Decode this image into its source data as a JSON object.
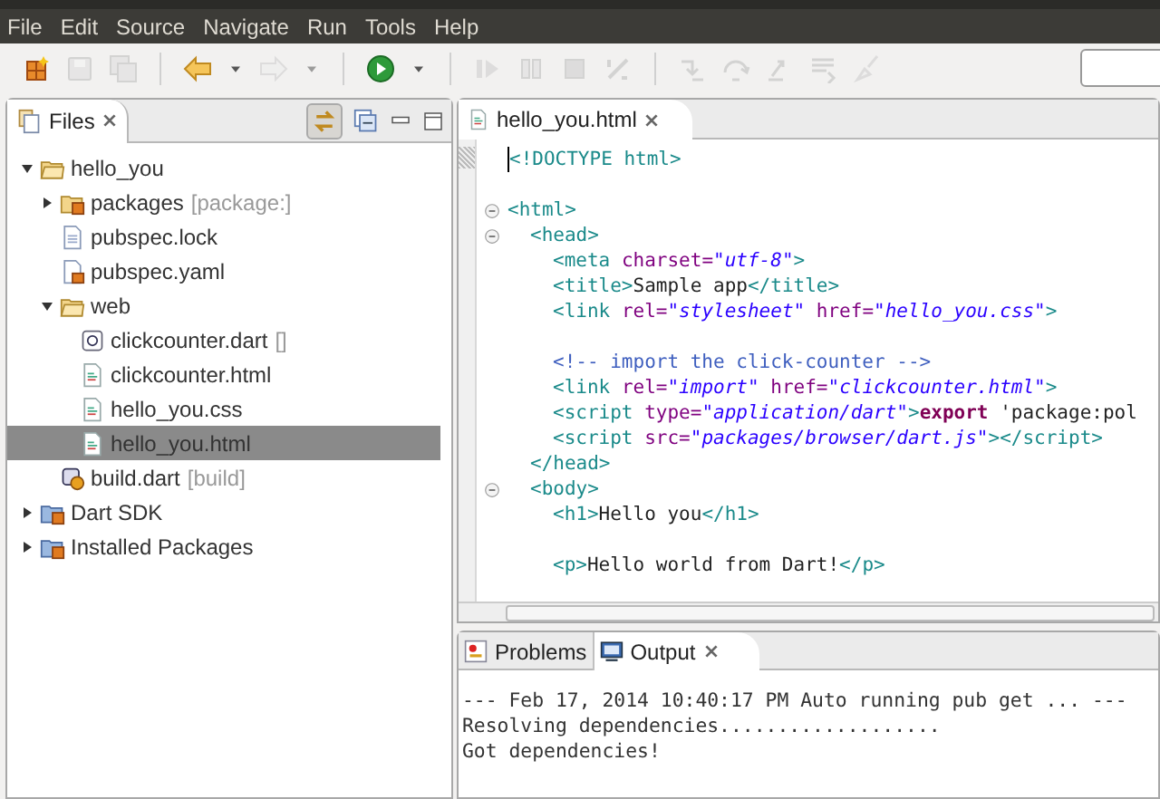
{
  "menu_bar": [
    "File",
    "Edit",
    "Source",
    "Navigate",
    "Run",
    "Tools",
    "Help"
  ],
  "toolbar": [
    {
      "kind": "new",
      "disabled": false
    },
    {
      "kind": "save",
      "disabled": true
    },
    {
      "kind": "save_all",
      "disabled": true
    },
    {
      "kind": "separator"
    },
    {
      "kind": "back",
      "disabled": false
    },
    {
      "kind": "dropdown",
      "disabled": false
    },
    {
      "kind": "forward",
      "disabled": true
    },
    {
      "kind": "dropdown",
      "disabled": true
    },
    {
      "kind": "separator"
    },
    {
      "kind": "run",
      "disabled": false
    },
    {
      "kind": "dropdown",
      "disabled": false
    },
    {
      "kind": "separator"
    },
    {
      "kind": "resume",
      "disabled": true
    },
    {
      "kind": "pause",
      "disabled": true
    },
    {
      "kind": "stop",
      "disabled": true
    },
    {
      "kind": "disconnect",
      "disabled": true
    },
    {
      "kind": "separator"
    },
    {
      "kind": "step_into",
      "disabled": true
    },
    {
      "kind": "step_over",
      "disabled": true
    },
    {
      "kind": "step_return",
      "disabled": true
    },
    {
      "kind": "step_filter",
      "disabled": true
    },
    {
      "kind": "brush",
      "disabled": true
    }
  ],
  "files_view": {
    "title": "Files",
    "link_editor": {
      "selected": true
    },
    "tree": [
      {
        "label": "hello_you",
        "kind": "folder",
        "expanded": true,
        "selected": false,
        "children": [
          {
            "label": "packages",
            "suffix": "[package:]",
            "kind": "package",
            "expanded": false,
            "selected": false
          },
          {
            "label": "pubspec.lock",
            "kind": "file",
            "selected": false
          },
          {
            "label": "pubspec.yaml",
            "kind": "pubspec",
            "selected": false
          },
          {
            "label": "web",
            "kind": "folder",
            "expanded": true,
            "selected": false,
            "children": [
              {
                "label": "clickcounter.dart",
                "suffix": "[]",
                "kind": "dart",
                "selected": false
              },
              {
                "label": "clickcounter.html",
                "kind": "html",
                "selected": false
              },
              {
                "label": "hello_you.css",
                "kind": "html",
                "selected": false
              },
              {
                "label": "hello_you.html",
                "kind": "html",
                "selected": true
              }
            ]
          },
          {
            "label": "build.dart",
            "suffix": "[build]",
            "kind": "build",
            "selected": false
          }
        ]
      },
      {
        "label": "Dart SDK",
        "kind": "library",
        "expanded": false,
        "selected": false
      },
      {
        "label": "Installed Packages",
        "kind": "library",
        "expanded": false,
        "selected": false
      }
    ]
  },
  "editor": {
    "tab": "hello_you.html",
    "lines": [
      {
        "kind": "code",
        "tokens": [
          {
            "kind": "tag",
            "text": "<!DOCTYPE html>"
          }
        ]
      },
      {
        "kind": "blank"
      },
      {
        "kind": "code",
        "tokens": [
          {
            "kind": "tag",
            "text": "<html>"
          }
        ],
        "children": [
          {
            "kind": "code",
            "tokens": [
              {
                "kind": "tag",
                "text": "<head>"
              }
            ],
            "children": [
              {
                "kind": "code",
                "tokens": [
                  {
                    "kind": "tag",
                    "text": "<meta "
                  },
                  {
                    "kind": "attr",
                    "text": "charset="
                  },
                  {
                    "kind": "value",
                    "text": "\"utf-8\""
                  },
                  {
                    "kind": "tag",
                    "text": ">"
                  }
                ]
              },
              {
                "kind": "code",
                "tokens": [
                  {
                    "kind": "tag",
                    "text": "<title>"
                  },
                  {
                    "kind": "text",
                    "text": "Sample app"
                  },
                  {
                    "kind": "tag",
                    "text": "</title>"
                  }
                ]
              },
              {
                "kind": "code",
                "tokens": [
                  {
                    "kind": "tag",
                    "text": "<link "
                  },
                  {
                    "kind": "attr",
                    "text": "rel="
                  },
                  {
                    "kind": "value",
                    "text": "\"stylesheet\""
                  },
                  {
                    "kind": "attr",
                    "text": " href="
                  },
                  {
                    "kind": "value",
                    "text": "\"hello_you.css\""
                  },
                  {
                    "kind": "tag",
                    "text": ">"
                  }
                ]
              },
              {
                "kind": "blank"
              },
              {
                "kind": "code",
                "tokens": [
                  {
                    "kind": "comment",
                    "text": "<!-- import the click-counter -->"
                  }
                ]
              },
              {
                "kind": "code",
                "tokens": [
                  {
                    "kind": "tag",
                    "text": "<link "
                  },
                  {
                    "kind": "attr",
                    "text": "rel="
                  },
                  {
                    "kind": "value",
                    "text": "\"import\""
                  },
                  {
                    "kind": "attr",
                    "text": " href="
                  },
                  {
                    "kind": "value",
                    "text": "\"clickcounter.html\""
                  },
                  {
                    "kind": "tag",
                    "text": ">"
                  }
                ]
              },
              {
                "kind": "code",
                "tokens": [
                  {
                    "kind": "tag",
                    "text": "<script "
                  },
                  {
                    "kind": "attr",
                    "text": "type="
                  },
                  {
                    "kind": "value",
                    "text": "\"application/dart\""
                  },
                  {
                    "kind": "tag",
                    "text": ">"
                  },
                  {
                    "kind": "keyword",
                    "text": "export"
                  },
                  {
                    "kind": "text",
                    "text": " 'package:pol"
                  }
                ]
              },
              {
                "kind": "code",
                "tokens": [
                  {
                    "kind": "tag",
                    "text": "<script "
                  },
                  {
                    "kind": "attr",
                    "text": "src="
                  },
                  {
                    "kind": "value",
                    "text": "\"packages/browser/dart.js\""
                  },
                  {
                    "kind": "tag",
                    "text": "></script>"
                  }
                ]
              }
            ]
          },
          {
            "kind": "code",
            "tokens": [
              {
                "kind": "tag",
                "text": "</head>"
              }
            ]
          },
          {
            "kind": "code",
            "tokens": [
              {
                "kind": "tag",
                "text": "<body>"
              }
            ],
            "children": [
              {
                "kind": "code",
                "tokens": [
                  {
                    "kind": "tag",
                    "text": "<h1>"
                  },
                  {
                    "kind": "text",
                    "text": "Hello you"
                  },
                  {
                    "kind": "tag",
                    "text": "</h1>"
                  }
                ]
              },
              {
                "kind": "blank"
              },
              {
                "kind": "code",
                "tokens": [
                  {
                    "kind": "tag",
                    "text": "<p>"
                  },
                  {
                    "kind": "text",
                    "text": "Hello world from Dart!"
                  },
                  {
                    "kind": "tag",
                    "text": "</p>"
                  }
                ]
              }
            ]
          }
        ]
      }
    ]
  },
  "bottom_panel": {
    "tabs": [
      {
        "label": "Problems",
        "kind": "problems",
        "selected": false
      },
      {
        "label": "Output",
        "kind": "console",
        "selected": true
      }
    ],
    "output": [
      "--- Feb 17, 2014 10:40:17 PM Auto running pub get ... ---",
      "Resolving dependencies...................",
      "Got dependencies!"
    ]
  }
}
